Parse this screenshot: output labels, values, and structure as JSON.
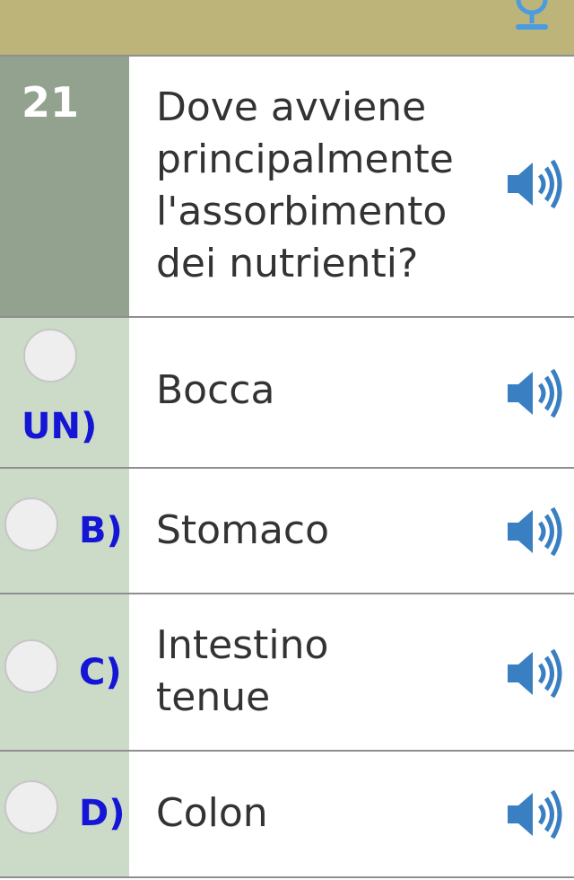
{
  "question": {
    "number": "21",
    "text": "Dove avviene principalmente l'assorbimento dei nutrienti?"
  },
  "options": [
    {
      "letter": "UN)",
      "text": "Bocca"
    },
    {
      "letter": "B)",
      "text": "Stomaco"
    },
    {
      "letter": "C)",
      "text": "Intestino tenue"
    },
    {
      "letter": "D)",
      "text": "Colon"
    }
  ],
  "icons": {
    "top_right": "microphone-icon",
    "speaker": "speaker-icon"
  },
  "colors": {
    "topbar": "#bdb47a",
    "question_number_bg": "#93a28f",
    "option_bg": "#cbdbc8",
    "letter": "#1515d6",
    "icon": "#3a7fc1"
  }
}
